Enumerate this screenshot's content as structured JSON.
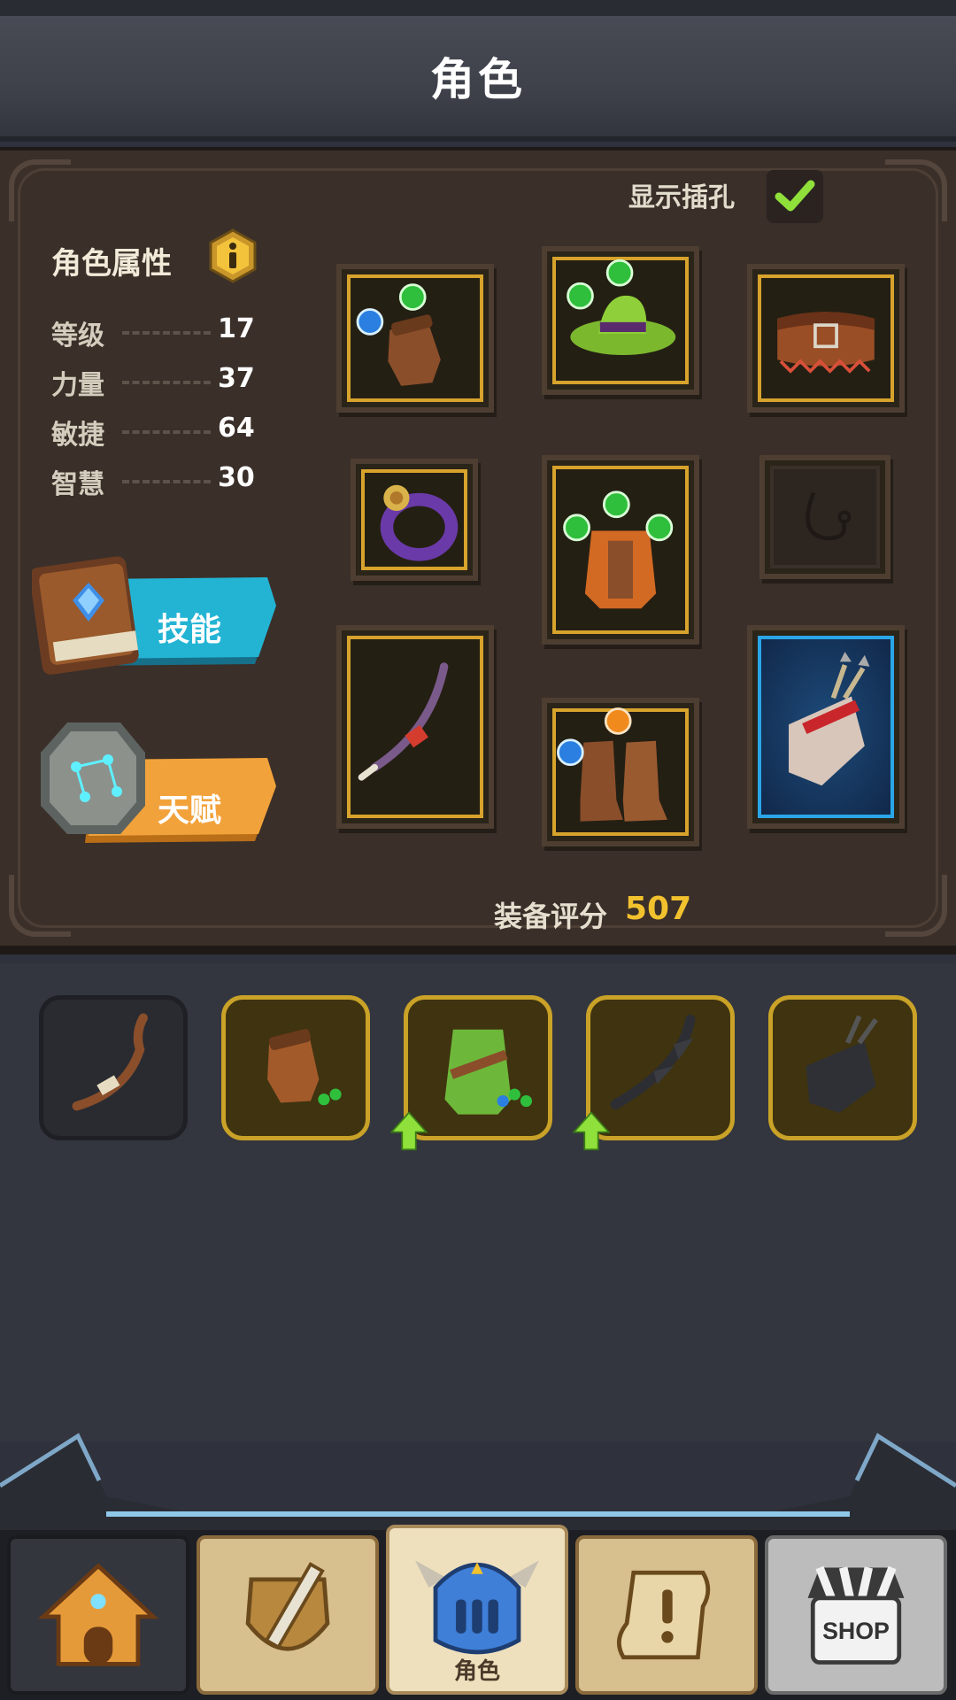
{
  "header": {
    "title": "角色"
  },
  "panel": {
    "show_sockets_label": "显示插孔",
    "show_sockets_checked": true,
    "attributes_title": "角色属性",
    "stats": [
      {
        "label": "等级",
        "value": "17"
      },
      {
        "label": "力量",
        "value": "37"
      },
      {
        "label": "敏捷",
        "value": "64"
      },
      {
        "label": "智慧",
        "value": "30"
      }
    ],
    "skill_button": "技能",
    "talent_button": "天赋",
    "gear_score_label": "装备评分",
    "gear_score_value": "507"
  },
  "equipment_slots": [
    {
      "item": "glove-icon",
      "sockets": [
        "blue",
        "green"
      ]
    },
    {
      "item": "hat-icon",
      "sockets": [
        "green",
        "green"
      ]
    },
    {
      "item": "belt-icon",
      "sockets": []
    },
    {
      "item": "ring-icon",
      "sockets": []
    },
    {
      "item": "armor-icon",
      "sockets": [
        "green",
        "green",
        "green"
      ]
    },
    {
      "item": "necklace-slot-icon",
      "sockets": []
    },
    {
      "item": "bow-icon",
      "sockets": []
    },
    {
      "item": "boots-icon",
      "sockets": [
        "blue",
        "orange"
      ]
    },
    {
      "item": "quiver-icon",
      "sockets": []
    }
  ],
  "inventory": [
    {
      "item": "bow-icon",
      "rarity": "common",
      "upgrade": false
    },
    {
      "item": "glove-icon",
      "rarity": "gold",
      "upgrade": false,
      "sockets": [
        "green",
        "green"
      ]
    },
    {
      "item": "armor-icon",
      "rarity": "gold",
      "upgrade": true,
      "sockets": [
        "blue",
        "green",
        "green"
      ]
    },
    {
      "item": "bow-icon",
      "rarity": "gold",
      "upgrade": true
    },
    {
      "item": "quiver-icon",
      "rarity": "gold",
      "upgrade": false
    }
  ],
  "nav": {
    "tabs": [
      {
        "icon": "home-icon"
      },
      {
        "icon": "battle-icon"
      },
      {
        "icon": "character-icon",
        "label": "角色",
        "active": true
      },
      {
        "icon": "quest-icon"
      },
      {
        "icon": "shop-icon",
        "text": "SHOP"
      }
    ]
  },
  "colors": {
    "gold_border": "#d7a32c",
    "score_value": "#f2c12e",
    "skill_button": "#1fa3c4",
    "talent_button": "#f2a23a",
    "socket_green": "#2fbf3c",
    "socket_blue": "#2a7fe0",
    "socket_orange": "#f08a1c"
  }
}
